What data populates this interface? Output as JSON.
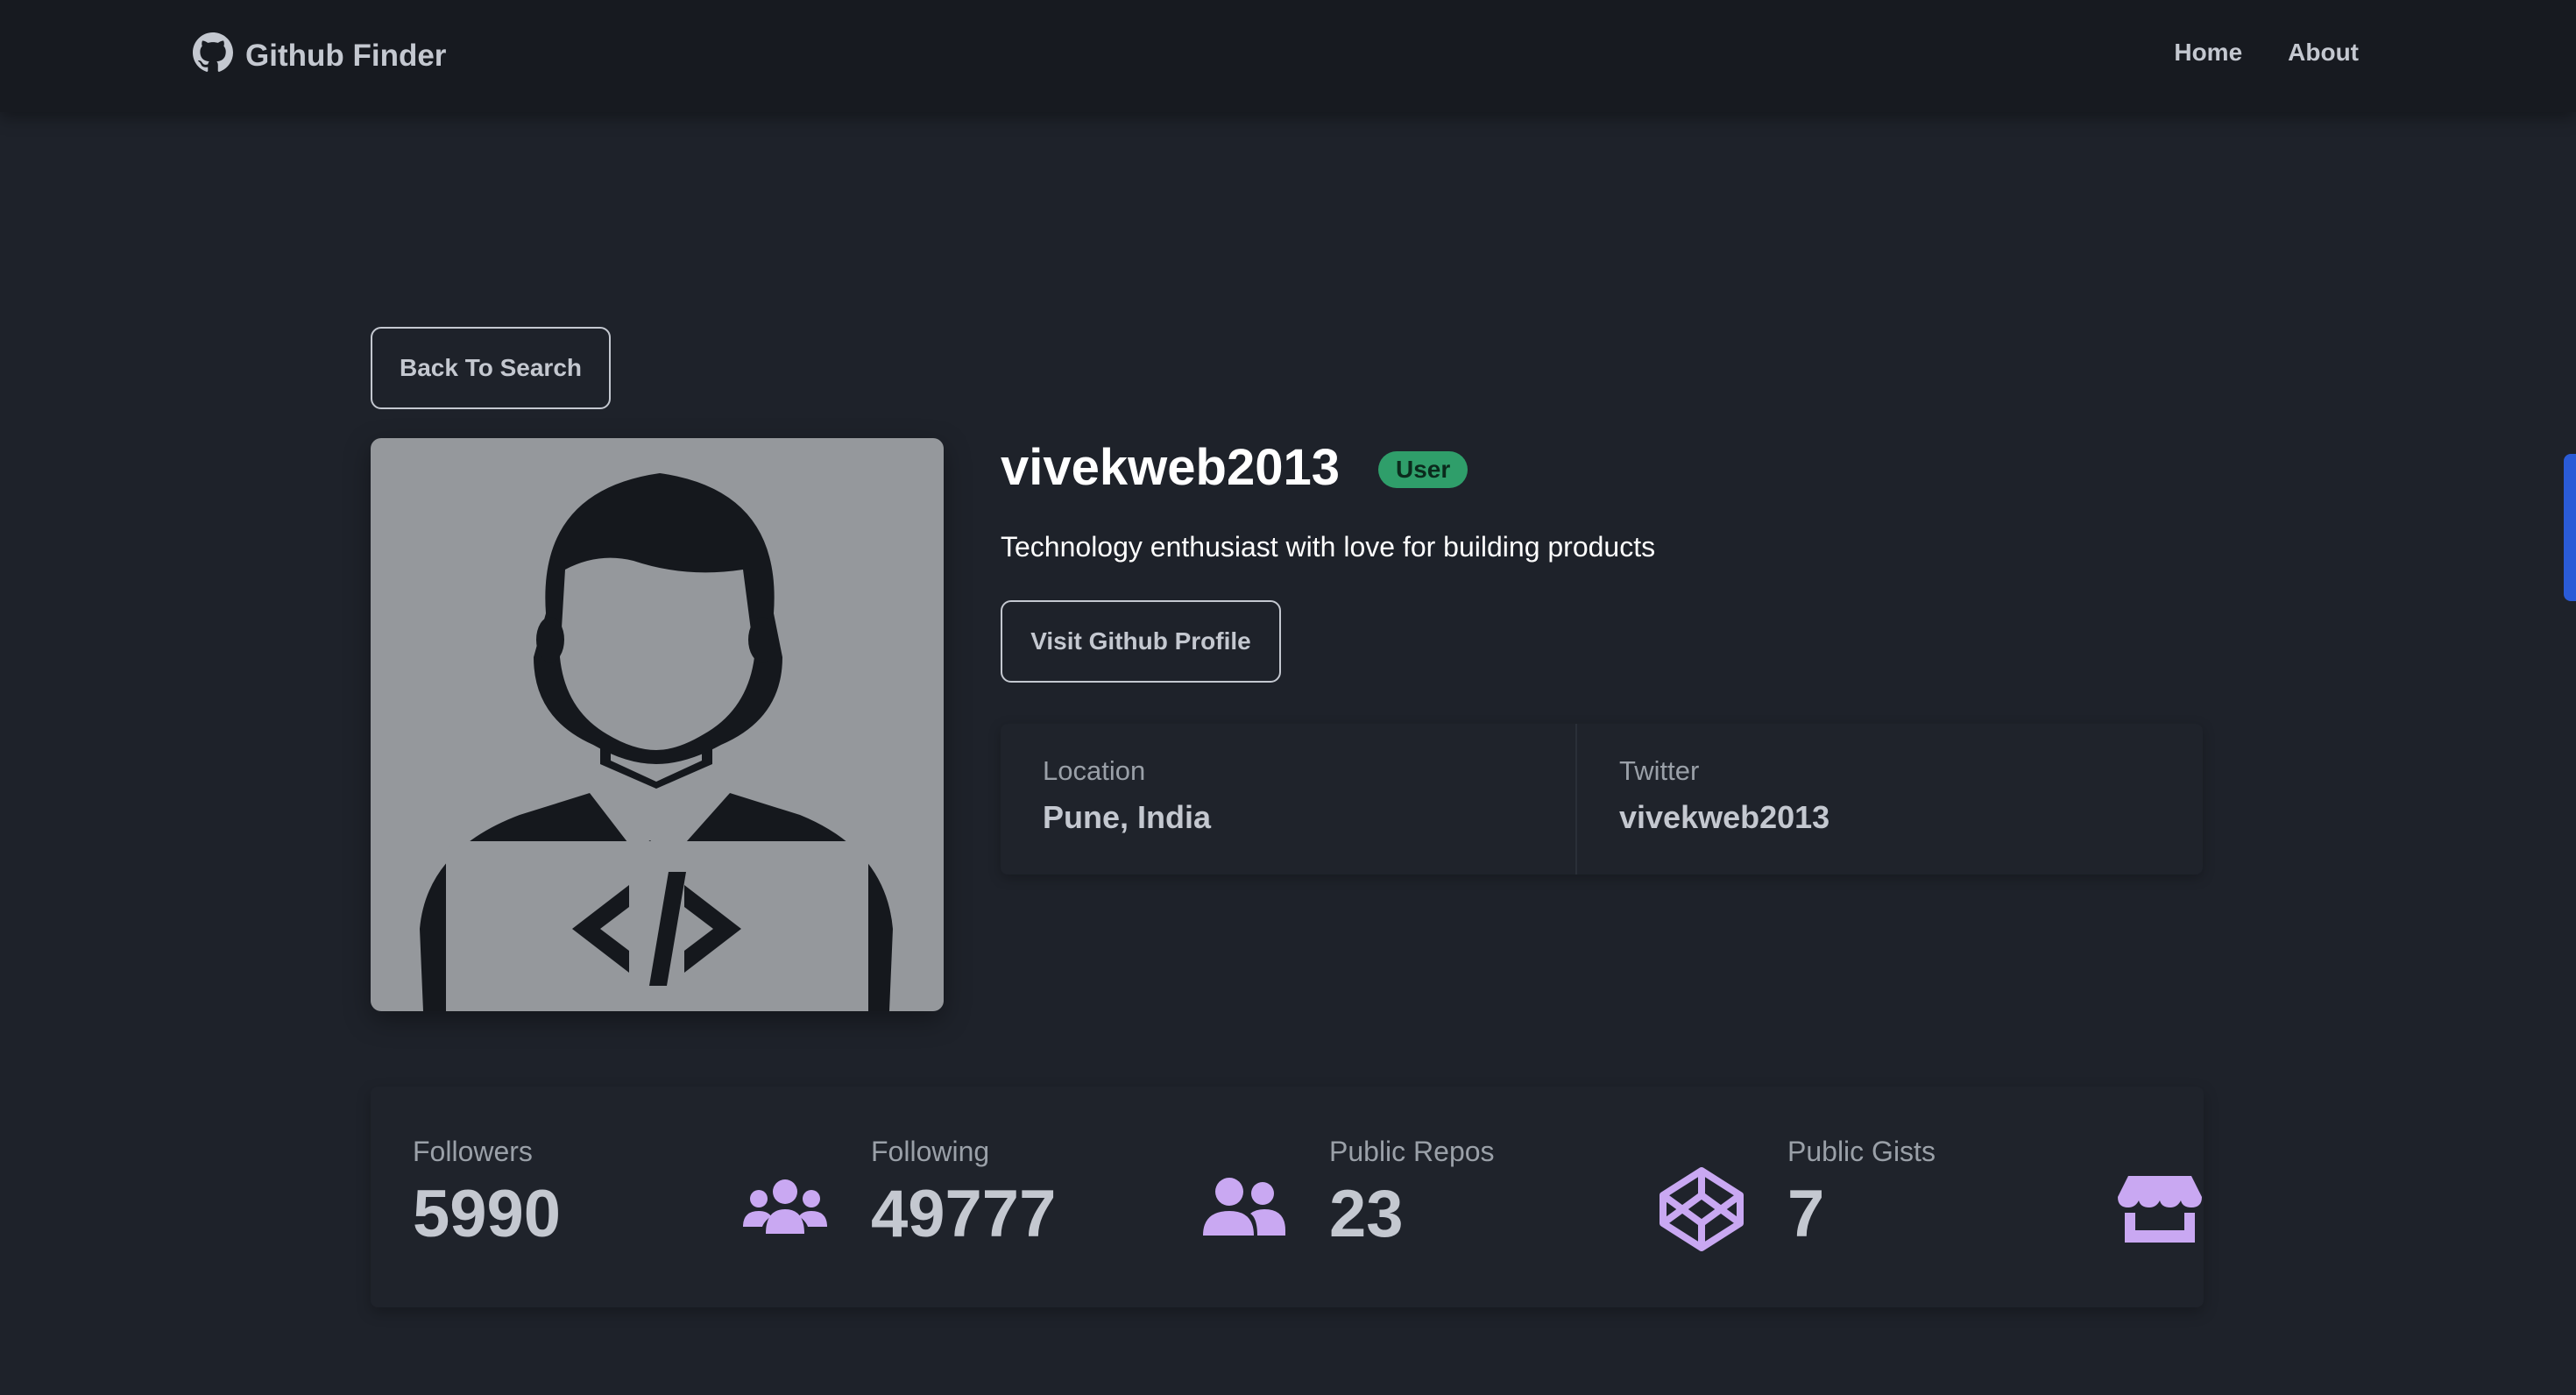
{
  "navbar": {
    "brand": "Github Finder",
    "links": [
      "Home",
      "About"
    ]
  },
  "buttons": {
    "back": "Back To Search",
    "visit": "Visit Github Profile"
  },
  "profile": {
    "name": "vivekweb2013",
    "login": "vivekweb2013",
    "type_badge": "User",
    "bio": "Technology enthusiast with love for building products"
  },
  "meta": [
    {
      "label": "Location",
      "value": "Pune, India"
    },
    {
      "label": "Twitter",
      "value": "vivekweb2013"
    }
  ],
  "stats": [
    {
      "label": "Followers",
      "value": "5990",
      "icon": "users-icon"
    },
    {
      "label": "Following",
      "value": "49777",
      "icon": "user-friends-icon"
    },
    {
      "label": "Public Repos",
      "value": "23",
      "icon": "codepen-icon"
    },
    {
      "label": "Public Gists",
      "value": "7",
      "icon": "store-icon"
    }
  ],
  "colors": {
    "background": "#1e222a",
    "navbar": "#171a20",
    "accent_icon": "#c9a8f2",
    "badge": "#2f9e6a"
  }
}
